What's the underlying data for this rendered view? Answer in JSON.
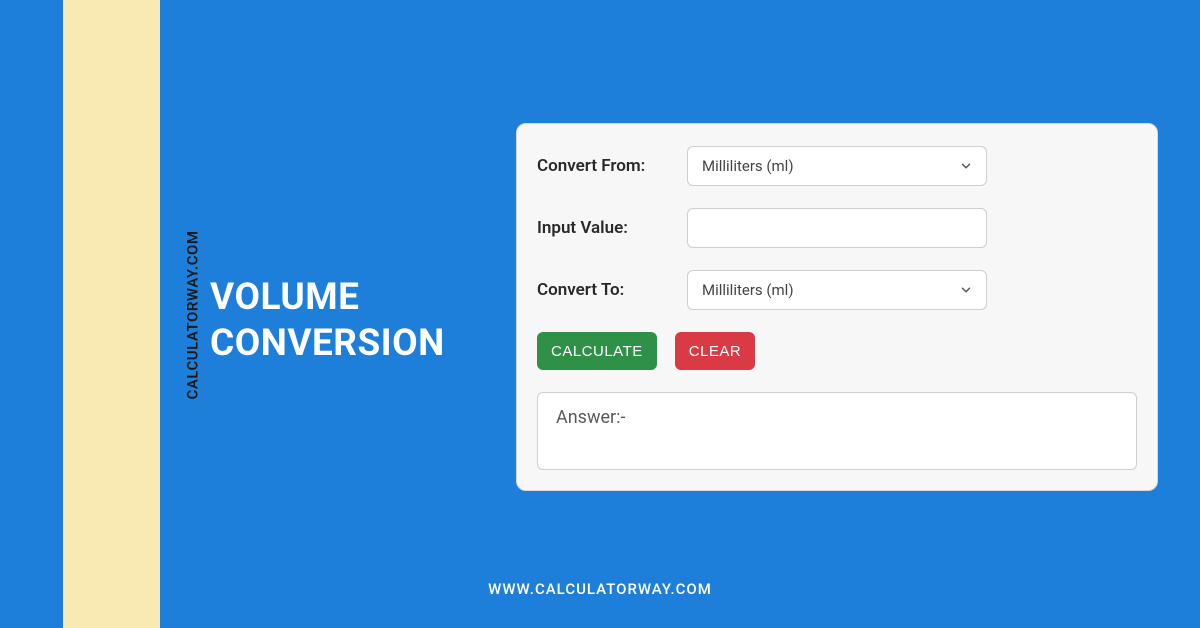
{
  "brand": {
    "vertical": "CALCULATORWAY.COM",
    "footer": "WWW.CALCULATORWAY.COM"
  },
  "title": {
    "line1": "VOLUME",
    "line2": "CONVERSION"
  },
  "form": {
    "convertFrom": {
      "label": "Convert From:",
      "selected": "Milliliters (ml)"
    },
    "inputValue": {
      "label": "Input Value:",
      "value": ""
    },
    "convertTo": {
      "label": "Convert To:",
      "selected": "Milliliters (ml)"
    },
    "buttons": {
      "calculate": "CALCULATE",
      "clear": "CLEAR"
    },
    "answer": {
      "label": "Answer:-"
    }
  }
}
